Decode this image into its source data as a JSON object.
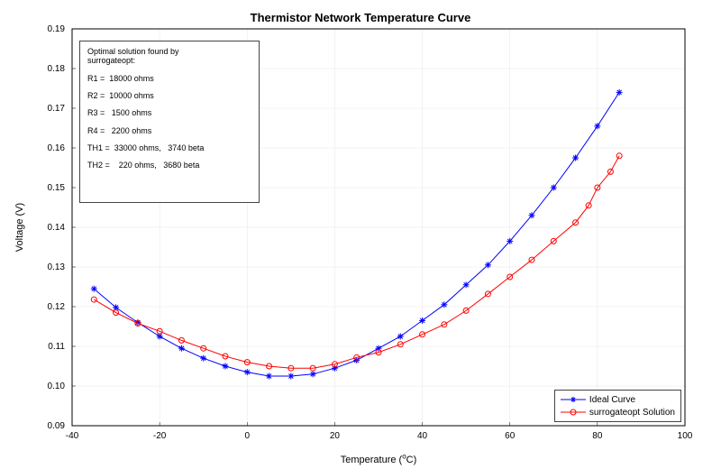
{
  "chart_data": {
    "type": "line",
    "title": "Thermistor Network Temperature Curve",
    "xlabel": "Temperature (°C)",
    "ylabel": "Voltage (V)",
    "xlim": [
      -40,
      100
    ],
    "ylim": [
      0.09,
      0.19
    ],
    "xticks": [
      -40,
      -20,
      0,
      20,
      40,
      60,
      80,
      100
    ],
    "yticks": [
      0.09,
      0.1,
      0.11,
      0.12,
      0.13,
      0.14,
      0.15,
      0.16,
      0.17,
      0.18,
      0.19
    ],
    "x": [
      -35,
      -30,
      -25,
      -20,
      -15,
      -10,
      -5,
      0,
      5,
      10,
      15,
      20,
      25,
      30,
      35,
      40,
      45,
      50,
      55,
      60,
      65,
      70,
      75,
      80,
      85
    ],
    "series": [
      {
        "name": "Ideal Curve",
        "color": "#0000ff",
        "marker": "asterisk",
        "values": [
          0.1245,
          0.1198,
          0.116,
          0.1125,
          0.1095,
          0.107,
          0.105,
          0.1035,
          0.1025,
          0.1025,
          0.103,
          0.1045,
          0.1065,
          0.1095,
          0.1125,
          0.1165,
          0.1205,
          0.1255,
          0.1305,
          0.1365,
          0.143,
          0.15,
          0.1575,
          0.1655,
          0.174
        ]
      },
      {
        "name": "surrogateopt Solution",
        "color": "#ff0000",
        "marker": "circle",
        "values": [
          0.1218,
          0.1185,
          0.1158,
          0.1138,
          0.1115,
          0.1095,
          0.1075,
          0.106,
          0.105,
          0.1045,
          0.1045,
          0.1055,
          0.1072,
          0.1085,
          0.1105,
          0.113,
          0.1155,
          0.119,
          0.1232,
          0.1275,
          0.1318,
          0.1365,
          0.1412,
          0.1455,
          0.15,
          0.154,
          0.158
        ]
      }
    ],
    "series_ideal_x": [
      -35,
      -30,
      -25,
      -20,
      -15,
      -10,
      -5,
      0,
      5,
      10,
      15,
      20,
      25,
      30,
      35,
      40,
      45,
      50,
      55,
      60,
      65,
      70,
      75,
      80,
      85
    ],
    "series_surrogate_x": [
      -35,
      -30,
      -25,
      -20,
      -15,
      -10,
      -5,
      0,
      5,
      10,
      15,
      20,
      25,
      30,
      35,
      40,
      45,
      50,
      55,
      60,
      65,
      70,
      75,
      78,
      80,
      83,
      85
    ]
  },
  "annotation": {
    "header": "Optimal solution found by\nsurrogateopt:",
    "lines": [
      "R1 =  18000 ohms",
      "R2 =  10000 ohms",
      "R3 =   1500 ohms",
      "R4 =   2200 ohms",
      "TH1 =  33000 ohms,   3740 beta",
      "TH2 =    220 ohms,   3680 beta"
    ]
  },
  "legend": {
    "entries": [
      {
        "label": "Ideal Curve",
        "color": "#0000ff",
        "marker": "asterisk"
      },
      {
        "label": "surrogateopt Solution",
        "color": "#ff0000",
        "marker": "circle"
      }
    ]
  }
}
